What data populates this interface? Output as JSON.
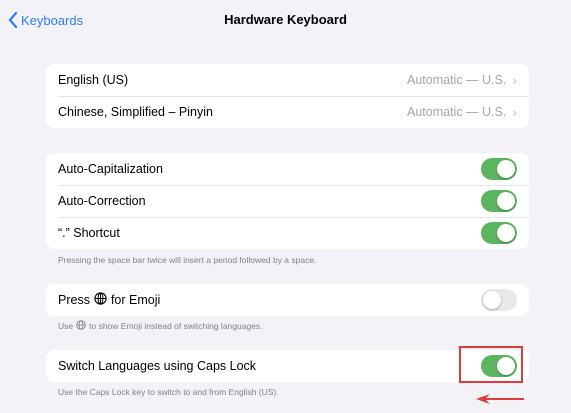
{
  "nav": {
    "back_label": "Keyboards",
    "title": "Hardware Keyboard"
  },
  "languages": [
    {
      "label": "English (US)",
      "value": "Automatic — U.S."
    },
    {
      "label": "Chinese, Simplified – Pinyin",
      "value": "Automatic — U.S."
    }
  ],
  "toggles": {
    "auto_capitalization": {
      "label": "Auto-Capitalization",
      "on": true
    },
    "auto_correction": {
      "label": "Auto-Correction",
      "on": true
    },
    "period_shortcut": {
      "label": "“.” Shortcut",
      "on": true
    },
    "period_footer": "Pressing the space bar twice will insert a period followed by a space.",
    "emoji": {
      "label_prefix": "Press",
      "label_suffix": "for Emoji",
      "on": false
    },
    "emoji_footer_prefix": "Use",
    "emoji_footer_suffix": "to show Emoji instead of switching languages.",
    "caps_lock": {
      "label": "Switch Languages using Caps Lock",
      "on": true
    },
    "caps_footer": "Use the Caps Lock key to switch to and from English (US)."
  },
  "colors": {
    "accent": "#2f7cf6",
    "toggle_on": "#5ab55e",
    "toggle_off": "#e8e8ea",
    "annotation": "#e03b3b",
    "background": "#f2f2f7"
  }
}
